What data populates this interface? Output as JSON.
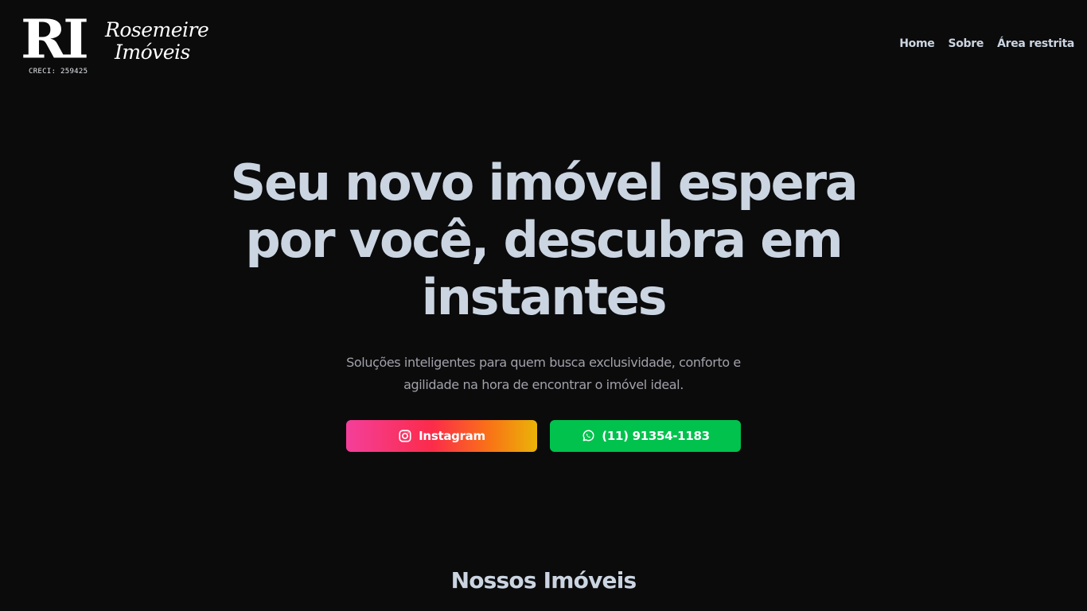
{
  "header": {
    "logo": {
      "mark": "RI",
      "name_line1": "Rosemeire",
      "name_line2": "Imóveis",
      "creci": "CRECI: 259425"
    },
    "nav": [
      {
        "label": "Home"
      },
      {
        "label": "Sobre"
      },
      {
        "label": "Área restrita"
      }
    ]
  },
  "hero": {
    "title_lines": [
      "Seu novo imóvel espera",
      "por você, descubra em",
      "instantes"
    ],
    "subtitle_lines": [
      "Soluções inteligentes para quem busca exclusividade, conforto e",
      "agilidade na hora de encontrar o imóvel ideal."
    ],
    "buttons": {
      "instagram": {
        "label": "Instagram",
        "icon": "instagram-icon"
      },
      "whatsapp": {
        "label": "(11) 91354-1183",
        "icon": "whatsapp-icon"
      }
    }
  },
  "section": {
    "title": "Nossos Imóveis"
  },
  "colors": {
    "background": "#0b0b0c",
    "text": "#cbd5e1",
    "muted": "#a1a1aa",
    "whatsapp": "#00c24d",
    "instagram_gradient": [
      "#f43f9a",
      "#fb2b4a",
      "#f97316",
      "#eab308"
    ]
  }
}
